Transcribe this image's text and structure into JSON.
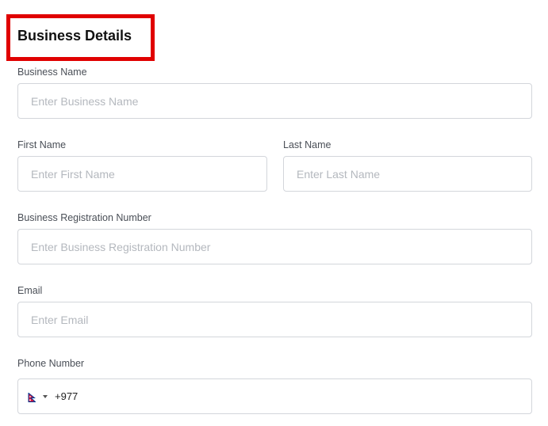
{
  "form": {
    "title": "Business Details",
    "business_name": {
      "label": "Business Name",
      "placeholder": "Enter Business Name",
      "value": ""
    },
    "first_name": {
      "label": "First Name",
      "placeholder": "Enter First Name",
      "value": ""
    },
    "last_name": {
      "label": "Last Name",
      "placeholder": "Enter Last Name",
      "value": ""
    },
    "registration_number": {
      "label": "Business Registration Number",
      "placeholder": "Enter Business Registration Number",
      "value": ""
    },
    "email": {
      "label": "Email",
      "placeholder": "Enter Email",
      "value": ""
    },
    "phone": {
      "label": "Phone Number",
      "country_flag_icon": "nepal-flag-icon",
      "value": "+977"
    }
  },
  "colors": {
    "highlight_border": "#e00000",
    "input_border": "#d3d6db",
    "placeholder": "#b4b8be",
    "label": "#4a4f57"
  }
}
